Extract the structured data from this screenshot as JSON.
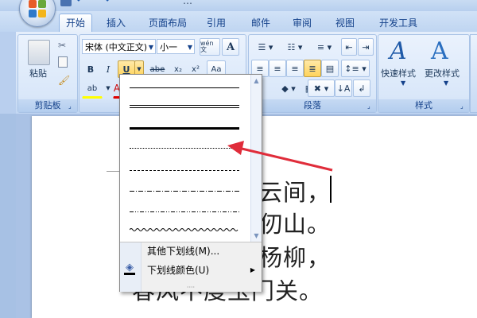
{
  "window": {
    "title": "…"
  },
  "ribbon_tabs": [
    "开始",
    "插入",
    "页面布局",
    "引用",
    "邮件",
    "审阅",
    "视图",
    "开发工具"
  ],
  "clipboard": {
    "paste_label": "粘贴",
    "group_label": "剪贴板"
  },
  "font": {
    "font_name": "宋体 (中文正文)",
    "font_size": "小一",
    "wen_label": "wén 文",
    "bold": "B",
    "italic": "I",
    "underline": "U",
    "strike": "abe",
    "subscript": "x₂",
    "superscript": "x²"
  },
  "paragraph": {
    "group_label": "段落"
  },
  "styles": {
    "quick_styles_label": "快速样式",
    "change_styles_label": "更改样式",
    "group_label": "样式",
    "glyph": "A"
  },
  "underline_menu": {
    "more_underlines": "其他下划线(M)...",
    "underline_color": "下划线颜色(U)"
  },
  "document": {
    "lines": [
      "云间，",
      "仞山。",
      "杨柳，",
      "春风不度玉门关。"
    ]
  },
  "colors": {
    "accent_arrow": "#e02c3a",
    "ribbon_border": "#8db2e3",
    "selected_button": "#ffd35a"
  }
}
